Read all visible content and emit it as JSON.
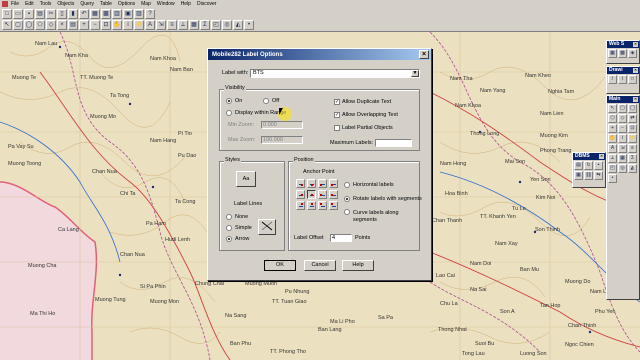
{
  "menubar": {
    "items": [
      "File",
      "Edit",
      "Tools",
      "Objects",
      "Query",
      "Table",
      "Options",
      "Map",
      "Window",
      "Help",
      "Discover"
    ]
  },
  "map": {
    "labels": [
      "Nam Lau",
      "Nam Kha",
      "Nam Khoa",
      "Muong Te",
      "TT. Muong Te",
      "Ta Tong",
      "Nam Ban",
      "Muong Toong",
      "Pa Vay Su",
      "Pi Tio",
      "Nam Hang",
      "Pu Dao",
      "Muong Mo",
      "Chan Nua",
      "Chi Ta",
      "Ca Lang",
      "Ta Cong",
      "Chan Nua",
      "Pa Ham",
      "Hudi Lenh",
      "Muong Cha",
      "Muong Tung",
      "Si Pa Phin",
      "Chung Chai",
      "Na Sang",
      "Muong Muon",
      "Ma Thi Ho",
      "Muong Mon",
      "Pu Nhung",
      "TT. Tuan Giao",
      "Ban Phu",
      "TT. Phong Tho",
      "Ban Lang",
      "Ma Li Pho",
      "Sa Pa",
      "Thong Nhat",
      "Lao Cai",
      "TT. Khanh Yen",
      "Yen Son",
      "Chan Thanh",
      "Thong Long",
      "Nam Tha",
      "Nam Kheo",
      "Nam Yang",
      "Muong Kim",
      "Phong Trang",
      "Tu Le",
      "Nam Lien",
      "Nam Xay",
      "Nam Doi",
      "Ban Mu",
      "Na Sai",
      "Muong Do",
      "Nam Lanh",
      "Tan Hop",
      "Son A",
      "Suoi Bu",
      "Chan Thinh",
      "Hoa Binh",
      "Ngoc Chien",
      "Tong Lau",
      "Chu La",
      "Luong Son",
      "Nam Hong",
      "Nghia Tam",
      "Mai Son",
      "Nam Khoa",
      "Kim Noi",
      "Son Thinh",
      "Phu Yen"
    ]
  },
  "dialog": {
    "title": "Mobile282 Label Options",
    "close_label": "×",
    "label_with_label": "Label with:",
    "label_with_value": "BTS",
    "visibility": {
      "title": "Visibility",
      "on_label": "On",
      "off_label": "Off",
      "display_within_range_label": "Display within Range",
      "min_zoom_label": "Min Zoom:",
      "min_zoom_value": "0.000",
      "max_zoom_label": "Max Zoom:",
      "max_zoom_value": "100.000",
      "allow_duplicate_label": "Allow Duplicate Text",
      "allow_overlapping_label": "Allow Overlapping Text",
      "label_partial_label": "Label Partial Objects",
      "maximum_labels_label": "Maximum Labels:",
      "maximum_labels_value": ""
    },
    "styles": {
      "title": "Styles",
      "font_button_label": "Aa",
      "label_lines_label": "Label Lines",
      "none_label": "None",
      "simple_label": "Simple",
      "arrow_label": "Arrow"
    },
    "position": {
      "title": "Position",
      "anchor_point_label": "Anchor Point",
      "horizontal_label": "Horizontal labels",
      "rotate_label": "Rotate labels with segments",
      "curve_label": "Curve labels along segments",
      "label_offset_label": "Label Offset",
      "label_offset_value": "4",
      "points_label": "Points"
    },
    "ok_label": "OK",
    "cancel_label": "Cancel",
    "help_label": "Help"
  },
  "palettes": {
    "web": "Web S",
    "drawing": "Drawi",
    "main": "Main",
    "dbms": "DBMS"
  },
  "colors": {
    "titlebar": "#0a246a",
    "map_background": "#ebe0bf",
    "border_highlight": "#e0607a"
  }
}
